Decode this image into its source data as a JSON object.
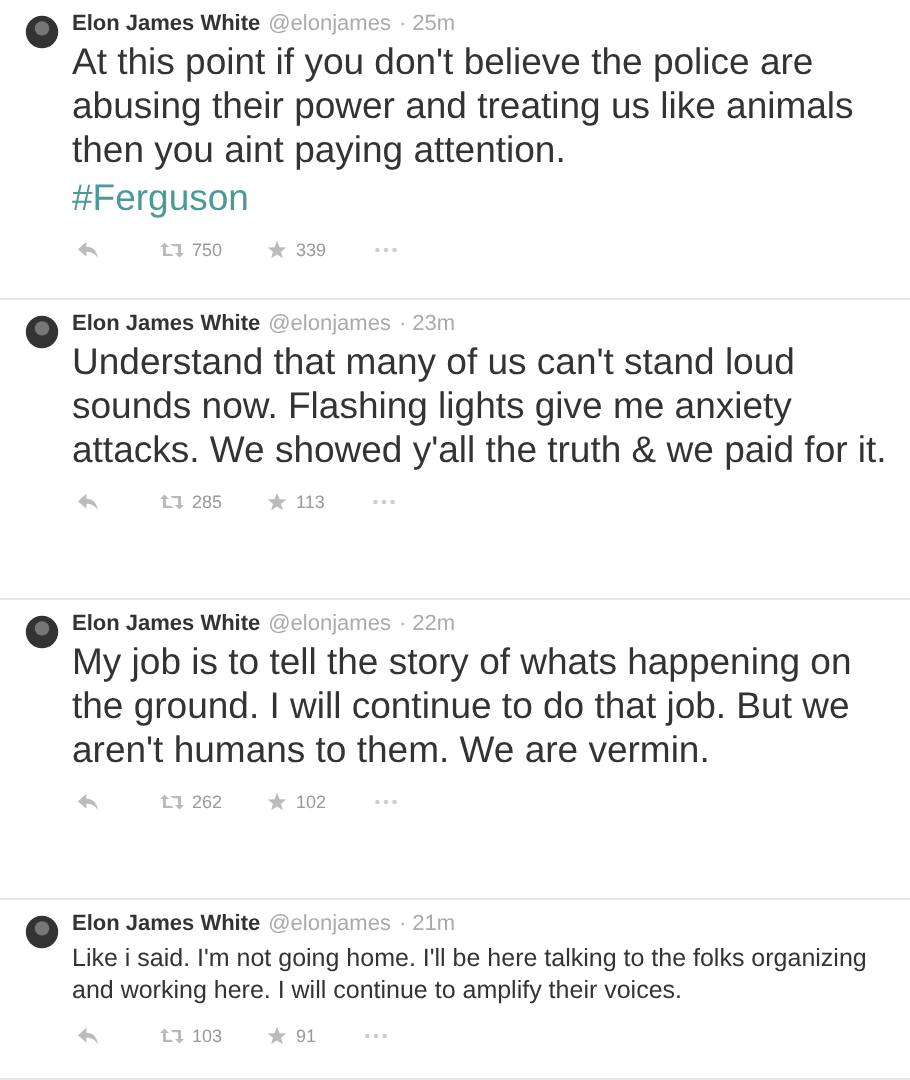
{
  "tweets": [
    {
      "name": "Elon James White",
      "handle": "@elonjames",
      "time": "· 25m",
      "kind": "large",
      "text": "At this point if you don't believe the police are abusing their power and treating us like animals then you aint paying attention.",
      "hashtag": "#Ferguson",
      "retweets": "750",
      "favorites": "339"
    },
    {
      "name": "Elon James White",
      "handle": "@elonjames",
      "time": "· 23m",
      "kind": "large",
      "text": "Understand that many of us can't stand loud sounds now. Flashing lights give me anxiety attacks. We showed y'all the truth & we paid for it.",
      "retweets": "285",
      "favorites": "113"
    },
    {
      "name": "Elon James White",
      "handle": "@elonjames",
      "time": "· 22m",
      "kind": "large",
      "text": "My job is to tell the story of whats happening on the ground. I will continue to do that job. But we aren't humans to them. We are vermin.",
      "retweets": "262",
      "favorites": "102"
    },
    {
      "name": "Elon James White",
      "handle": "@elonjames",
      "time": "· 21m",
      "kind": "normal",
      "text": "Like i said. I'm not going home. I'll be here talking to the folks organizing and working here. I will continue to amplify their voices.",
      "retweets": "103",
      "favorites": "91"
    }
  ]
}
